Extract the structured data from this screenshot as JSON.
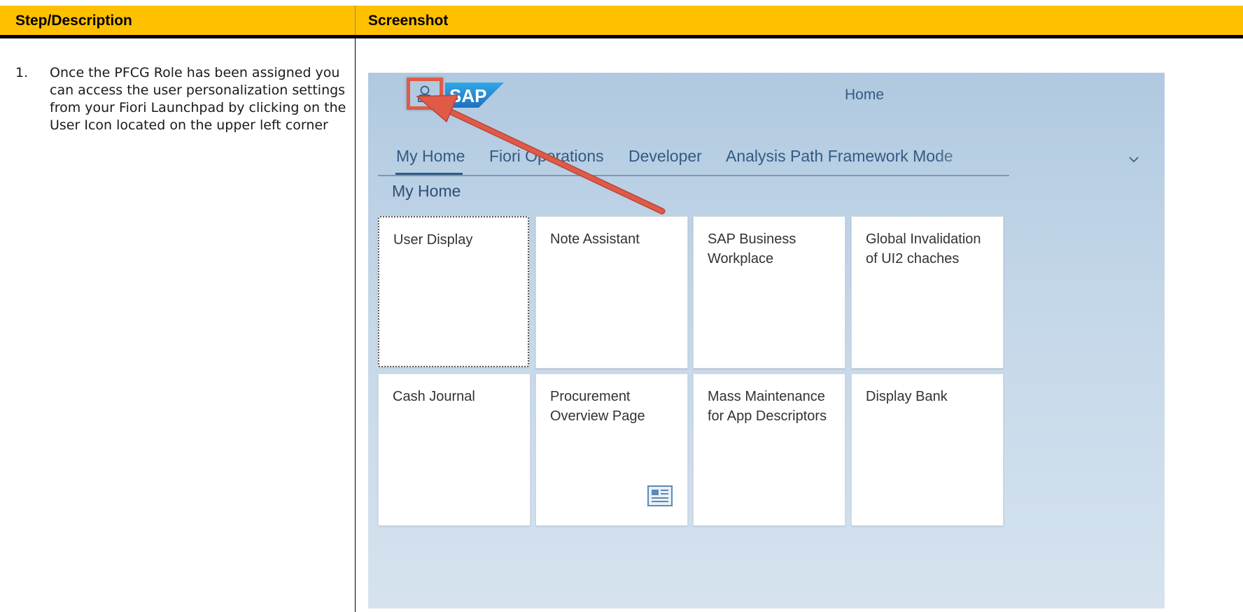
{
  "table": {
    "col1_header": "Step/Description",
    "col2_header": "Screenshot",
    "header_color": "#FFC000"
  },
  "step": {
    "number": "1.",
    "text": "Once the PFCG Role has been assigned you can access the user personalization settings from your Fiori Launchpad by clicking on the User Icon located on the upper left corner"
  },
  "launchpad": {
    "title": "Home",
    "user_icon": "user-icon",
    "logo": "SAP",
    "tabs": [
      {
        "label": "My Home",
        "active": true
      },
      {
        "label": "Fiori Operations",
        "active": false
      },
      {
        "label": "Developer",
        "active": false
      },
      {
        "label": "Analysis Path Framework Mode",
        "active": false
      }
    ],
    "more_icon": "chevron-down-icon",
    "section_title": "My Home",
    "tiles": [
      {
        "title": "User Display"
      },
      {
        "title": "Note Assistant"
      },
      {
        "title": "SAP Business Workplace"
      },
      {
        "title": "Global Invalidation of UI2 chaches"
      },
      {
        "title": "Cash Journal"
      },
      {
        "title": "Procurement Overview Page",
        "icon": "overview-page-icon"
      },
      {
        "title": "Mass Maintenance for App Descriptors"
      },
      {
        "title": "Display Bank"
      }
    ],
    "annotation_color": "#e05a48"
  }
}
